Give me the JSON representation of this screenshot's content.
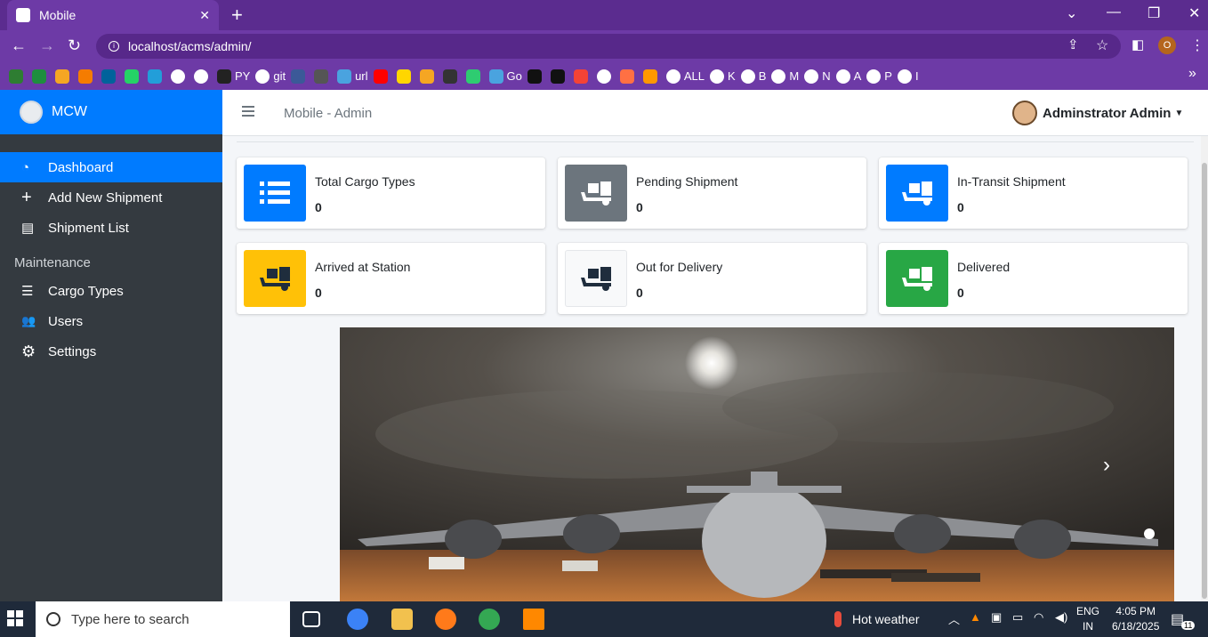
{
  "browser": {
    "tab_title": "Mobile",
    "tab_close": "✕",
    "new_tab": "+",
    "url": "localhost/acms/admin/",
    "profile_initial": "O",
    "bookmarks": [
      {
        "label": "",
        "icon": "brand-icon",
        "color": "#2e7d32"
      },
      {
        "label": "",
        "icon": "plus-icon",
        "color": "#1e8e3e"
      },
      {
        "label": "",
        "icon": "gift-icon",
        "color": "#f5a623"
      },
      {
        "label": "",
        "icon": "chart-icon",
        "color": "#f57c00"
      },
      {
        "label": "",
        "icon": "ieee-icon",
        "color": "#00629b"
      },
      {
        "label": "",
        "icon": "whatsapp-icon",
        "color": "#25d366"
      },
      {
        "label": "",
        "icon": "telegram-icon",
        "color": "#229ed9"
      },
      {
        "label": "",
        "icon": "google-icon",
        "color": "#ffffff"
      },
      {
        "label": "",
        "icon": "google-icon",
        "color": "#ffffff"
      },
      {
        "label": "PY",
        "icon": "github-icon",
        "color": "#222222"
      },
      {
        "label": "git",
        "icon": "google-icon",
        "color": "#ffffff"
      },
      {
        "label": "",
        "icon": "grid-icon",
        "color": "#3b5998"
      },
      {
        "label": "",
        "icon": "car-icon",
        "color": "#555555"
      },
      {
        "label": "url",
        "icon": "cloud-icon",
        "color": "#4aa3df"
      },
      {
        "label": "",
        "icon": "youtube-icon",
        "color": "#ff0000"
      },
      {
        "label": "",
        "icon": "p-icon",
        "color": "#ffd600"
      },
      {
        "label": "",
        "icon": "film-icon",
        "color": "#f5a623"
      },
      {
        "label": "",
        "icon": "lion-icon",
        "color": "#333333"
      },
      {
        "label": "",
        "icon": "circle-icon",
        "color": "#2ecc71"
      },
      {
        "label": "Go",
        "icon": "swirl-icon",
        "color": "#4aa3df"
      },
      {
        "label": "",
        "icon": "image-icon",
        "color": "#111111"
      },
      {
        "label": "",
        "icon": "ci-icon",
        "color": "#111111"
      },
      {
        "label": "",
        "icon": "yandex-icon",
        "color": "#f44336"
      },
      {
        "label": "",
        "icon": "google-icon",
        "color": "#ffffff"
      },
      {
        "label": "",
        "icon": "leaf-icon",
        "color": "#ff7043"
      },
      {
        "label": "",
        "icon": "eye-icon",
        "color": "#ff9800"
      },
      {
        "label": "ALL",
        "icon": "globe-icon",
        "color": "#ffffff"
      },
      {
        "label": "K",
        "icon": "google-icon",
        "color": "#ffffff"
      },
      {
        "label": "B",
        "icon": "google-icon",
        "color": "#ffffff"
      },
      {
        "label": "M",
        "icon": "google-icon",
        "color": "#ffffff"
      },
      {
        "label": "N",
        "icon": "google-icon",
        "color": "#ffffff"
      },
      {
        "label": "A",
        "icon": "google-icon",
        "color": "#ffffff"
      },
      {
        "label": "P",
        "icon": "google-icon",
        "color": "#ffffff"
      },
      {
        "label": "I",
        "icon": "google-icon",
        "color": "#ffffff"
      }
    ],
    "more_bookmarks": "»"
  },
  "app": {
    "brand": "MCW",
    "page_title": "Mobile - Admin",
    "user_name": "Adminstrator Admin",
    "sidebar": {
      "items": [
        {
          "label": "Dashboard",
          "icon": "dashboard-icon",
          "glyph": "◔",
          "active": true
        },
        {
          "label": "Add New Shipment",
          "icon": "plus-icon",
          "glyph": "+",
          "active": false
        },
        {
          "label": "Shipment List",
          "icon": "dolly-icon",
          "glyph": "▤",
          "active": false
        }
      ],
      "section_header": "Maintenance",
      "maintenance_items": [
        {
          "label": "Cargo Types",
          "icon": "table-icon",
          "glyph": "☰"
        },
        {
          "label": "Users",
          "icon": "users-icon",
          "glyph": "👥"
        },
        {
          "label": "Settings",
          "icon": "cogs-icon",
          "glyph": "⚙"
        }
      ]
    },
    "cards": [
      {
        "label": "Total Cargo Types",
        "value": "0",
        "color": "#007bff",
        "icon": "list-icon"
      },
      {
        "label": "Pending Shipment",
        "value": "0",
        "color": "#6c757d",
        "icon": "dolly-icon"
      },
      {
        "label": "In-Transit Shipment",
        "value": "0",
        "color": "#007bff",
        "icon": "dolly-icon"
      },
      {
        "label": "Arrived at Station",
        "value": "0",
        "color": "#ffc107",
        "icon": "dolly-icon"
      },
      {
        "label": "Out for Delivery",
        "value": "0",
        "color": "#f8f9fa",
        "icon": "dolly-icon"
      },
      {
        "label": "Delivered",
        "value": "0",
        "color": "#28a745",
        "icon": "dolly-icon"
      }
    ],
    "carousel_next": "›"
  },
  "taskbar": {
    "search_placeholder": "Type here to search",
    "weather": "Hot weather",
    "lang_top": "ENG",
    "lang_bottom": "IN",
    "time": "4:05 PM",
    "date": "6/18/2025",
    "notif_count": "11"
  }
}
